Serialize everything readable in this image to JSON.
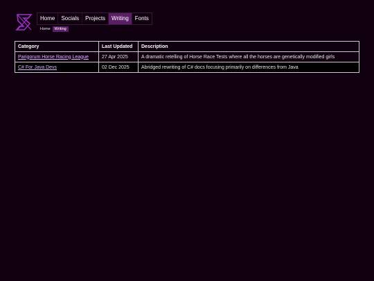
{
  "nav": {
    "items": [
      "Home",
      "Socials",
      "Projects",
      "Writing",
      "Fonts"
    ],
    "active": "Writing"
  },
  "breadcrumb": {
    "items": [
      "Home",
      "Writing"
    ]
  },
  "table": {
    "headers": [
      "Category",
      "Last Updated",
      "Description"
    ],
    "rows": [
      [
        "Parigorum Horse Racing League",
        "27 Apr 2025",
        "A dramatic retelling of Horse Race Tests where all the horses are genetically modified girls"
      ],
      [
        "C# For Java Devs",
        "02 Dec 2025",
        "Abridged rewriting of C# docs focusing primarily on differences from Java"
      ]
    ]
  },
  "colors": {
    "background": "#110010",
    "accent": "#5a1f66",
    "link": "#d9b3ff",
    "logo": "#9b30c9"
  }
}
